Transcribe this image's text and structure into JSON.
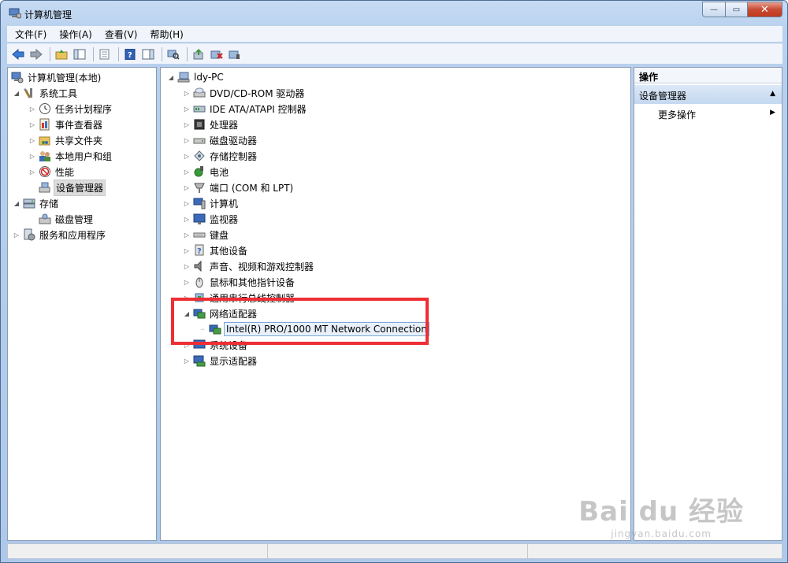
{
  "window": {
    "title": "计算机管理",
    "buttons": {
      "minimize": "—",
      "maximize": "▭",
      "close": "✕"
    }
  },
  "menu": [
    "文件(F)",
    "操作(A)",
    "查看(V)",
    "帮助(H)"
  ],
  "left_tree": {
    "root": "计算机管理(本地)",
    "system_tools": "系统工具",
    "system_items": [
      "任务计划程序",
      "事件查看器",
      "共享文件夹",
      "本地用户和组",
      "性能",
      "设备管理器"
    ],
    "storage": "存储",
    "storage_items": [
      "磁盘管理"
    ],
    "services": "服务和应用程序"
  },
  "device_tree": {
    "root": "ldy-PC",
    "categories": [
      "DVD/CD-ROM 驱动器",
      "IDE ATA/ATAPI 控制器",
      "处理器",
      "磁盘驱动器",
      "存储控制器",
      "电池",
      "端口 (COM 和 LPT)",
      "计算机",
      "监视器",
      "键盘",
      "其他设备",
      "声音、视频和游戏控制器",
      "鼠标和其他指针设备",
      "通用串行总线控制器",
      "网络适配器",
      "系统设备",
      "显示适配器"
    ],
    "network_child": "Intel(R) PRO/1000 MT Network Connection"
  },
  "actions": {
    "header": "操作",
    "section": "设备管理器",
    "more": "更多操作"
  },
  "watermark": {
    "brand": "Bai du 经验",
    "url": "jingyan.baidu.com"
  },
  "colors": {
    "highlight": "#ee2e34",
    "section_bg": "#c4d8f0"
  }
}
